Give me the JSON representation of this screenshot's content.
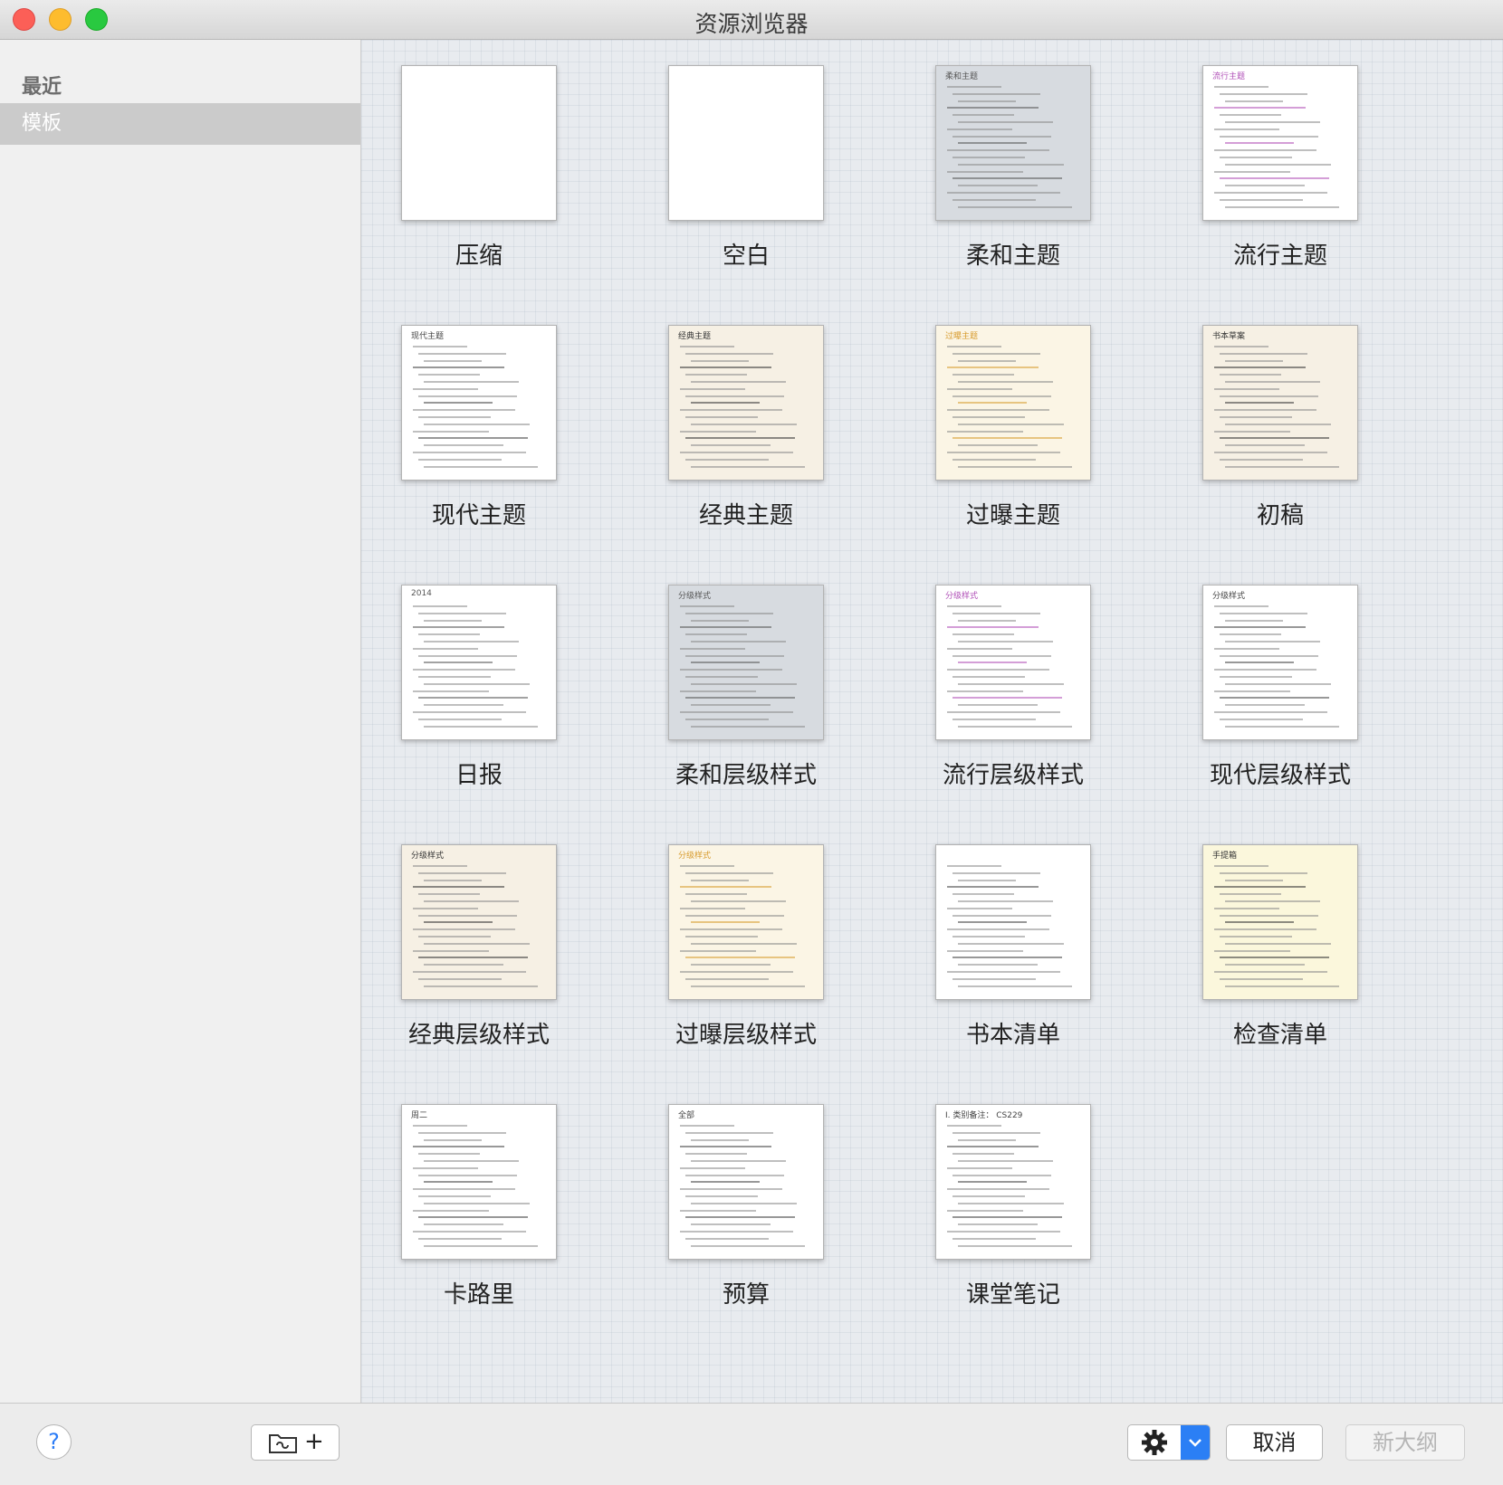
{
  "window": {
    "title": "资源浏览器"
  },
  "sidebar": {
    "items": [
      {
        "label": "最近",
        "selected": false
      },
      {
        "label": "模板",
        "selected": true
      }
    ]
  },
  "templates": [
    {
      "label": "压缩",
      "thumb_bg": "#ffffff",
      "header": "",
      "header_color": "#444444"
    },
    {
      "label": "空白",
      "thumb_bg": "#ffffff",
      "header": "",
      "header_color": "#444444"
    },
    {
      "label": "柔和主题",
      "thumb_bg": "#d7dbe0",
      "header": "柔和主题",
      "header_color": "#555555"
    },
    {
      "label": "流行主题",
      "thumb_bg": "#ffffff",
      "header": "流行主题",
      "header_color": "#b04fb7"
    },
    {
      "label": "现代主题",
      "thumb_bg": "#ffffff",
      "header": "现代主题",
      "header_color": "#444444"
    },
    {
      "label": "经典主题",
      "thumb_bg": "#f6f0e4",
      "header": "经典主题",
      "header_color": "#333333"
    },
    {
      "label": "过曝主题",
      "thumb_bg": "#fbf5e5",
      "header": "过曝主题",
      "header_color": "#d79b2d"
    },
    {
      "label": "初稿",
      "thumb_bg": "#f6f0e4",
      "header": "书本草案",
      "header_color": "#333333"
    },
    {
      "label": "日报",
      "thumb_bg": "#ffffff",
      "header": "2014",
      "header_color": "#555555"
    },
    {
      "label": "柔和层级样式",
      "thumb_bg": "#d7dbe0",
      "header": "分级样式",
      "header_color": "#555555"
    },
    {
      "label": "流行层级样式",
      "thumb_bg": "#ffffff",
      "header": "分级样式",
      "header_color": "#b04fb7"
    },
    {
      "label": "现代层级样式",
      "thumb_bg": "#ffffff",
      "header": "分级样式",
      "header_color": "#444444"
    },
    {
      "label": "经典层级样式",
      "thumb_bg": "#f6f0e4",
      "header": "分级样式",
      "header_color": "#333333"
    },
    {
      "label": "过曝层级样式",
      "thumb_bg": "#fbf5e5",
      "header": "分级样式",
      "header_color": "#d79b2d"
    },
    {
      "label": "书本清单",
      "thumb_bg": "#ffffff",
      "header": "",
      "header_color": "#444444"
    },
    {
      "label": "检查清单",
      "thumb_bg": "#fbf7dc",
      "header": "手提箱",
      "header_color": "#333333"
    },
    {
      "label": "卡路里",
      "thumb_bg": "#ffffff",
      "header": "周二",
      "header_color": "#444444"
    },
    {
      "label": "预算",
      "thumb_bg": "#ffffff",
      "header": "全部",
      "header_color": "#444444"
    },
    {
      "label": "课堂笔记",
      "thumb_bg": "#ffffff",
      "header": "I. 类别备注： CS229",
      "header_color": "#444444"
    }
  ],
  "footer": {
    "help_label": "?",
    "add_folder_plus": "+",
    "cancel_label": "取消",
    "new_outline_label": "新大纲",
    "new_outline_enabled": false
  },
  "colors": {
    "accent": "#2b7ff5",
    "sidebar_selected": "#cbcbcb",
    "content_bg": "#e8ebef"
  }
}
